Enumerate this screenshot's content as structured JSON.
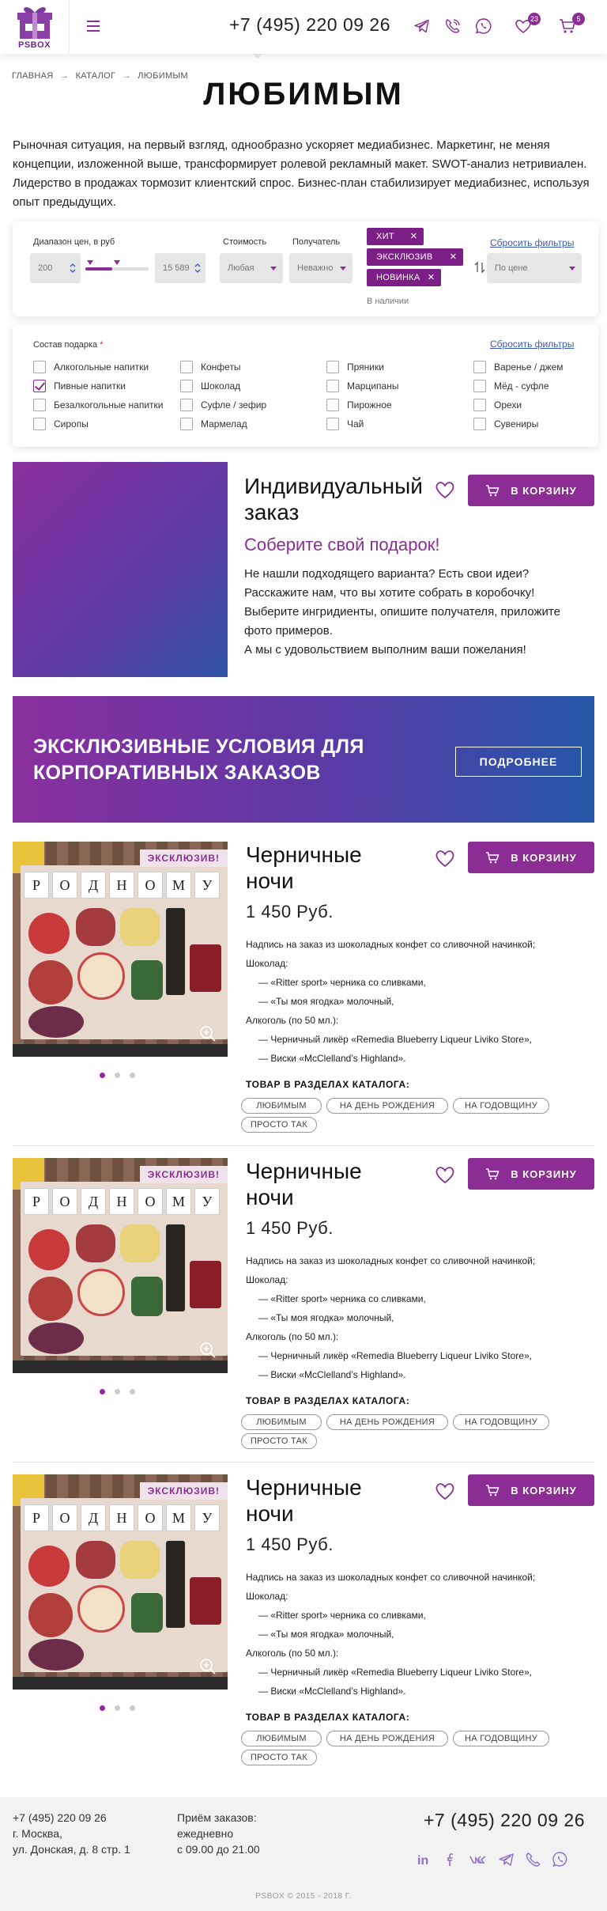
{
  "header": {
    "logo_text": "PSBOX",
    "phone": "+7 (495) 220 09 26",
    "favorites_count": "23",
    "cart_count": "5"
  },
  "breadcrumb": {
    "home": "ГЛАВНАЯ",
    "catalog": "КАТАЛОГ",
    "current": "ЛЮБИМЫМ",
    "separator": "→"
  },
  "page_title": "ЛЮБИМЫМ",
  "intro_text": "Рыночная ситуация, на первый взгляд, однообразно ускоряет медиабизнес. Маркетинг, не меняя концепции, изложенной выше, трансформирует ролевой рекламный макет. SWOT-анализ нетривиален. Лидерство в продажах тормозит клиентский спрос. Бизнес-план стабилизирует медиабизнес, используя опыт предыдущих.",
  "filters": {
    "price_label": "Диапазон цен, в руб",
    "price_min": "200",
    "price_max": "15 589",
    "price_range_fraction": [
      0.0,
      0.42
    ],
    "cost_label": "Стоимость",
    "cost_value": "Любая",
    "recipient_label": "Получатель",
    "recipient_value": "Неважно",
    "tags": [
      "ХИТ",
      "ЭКСКЛЮЗИВ",
      "НОВИНКА"
    ],
    "in_stock": "В наличии",
    "reset_label": "Сбросить фильтры",
    "sort_value": "По цене"
  },
  "composition": {
    "label": "Состав подарка",
    "required_mark": "*",
    "reset_label": "Сбросить фильтры",
    "items": [
      {
        "label": "Алкогольные напитки",
        "checked": false
      },
      {
        "label": "Конфеты",
        "checked": false
      },
      {
        "label": "Пряники",
        "checked": false
      },
      {
        "label": "Варенье / джем",
        "checked": false
      },
      {
        "label": "Пивные напитки",
        "checked": true
      },
      {
        "label": "Шоколад",
        "checked": false
      },
      {
        "label": "Марципаны",
        "checked": false
      },
      {
        "label": "Мёд - суфле",
        "checked": false
      },
      {
        "label": "Безалкогольные напитки",
        "checked": false
      },
      {
        "label": "Суфле / зефир",
        "checked": false
      },
      {
        "label": "Пирожное",
        "checked": false
      },
      {
        "label": "Орехи",
        "checked": false
      },
      {
        "label": "Сиропы",
        "checked": false
      },
      {
        "label": "Мармелад",
        "checked": false
      },
      {
        "label": "Чай",
        "checked": false
      },
      {
        "label": "Сувениры",
        "checked": false
      }
    ]
  },
  "custom_order": {
    "title_line1": "Индивидуальный",
    "title_line2": "заказ",
    "subtitle": "Соберите свой подарок!",
    "body_lines": [
      "Не нашли подходящего варианта? Есть свои идеи?",
      "Расскажите нам, что вы хотите собрать в коробочку!",
      "Выберите ингридиенты, опишите получателя, приложите",
      "фото примеров.",
      "А мы с удовольствием выполним ваши пожелания!"
    ],
    "cart_label": "В КОРЗИНУ"
  },
  "promo": {
    "title_line1": "ЭКСКЛЮЗИВНЫЕ УСЛОВИЯ ДЛЯ",
    "title_line2": "КОРПОРАТИВНЫХ ЗАКАЗОВ",
    "button_label": "ПОДРОБНЕЕ"
  },
  "products": [
    {
      "name_line1": "Черничные",
      "name_line2": "ночи",
      "price": "1 450 Руб.",
      "ribbon": "ЭКСКЛЮЗИВ!",
      "cart_label": "В КОРЗИНУ",
      "tile_letters": [
        "Р",
        "О",
        "Д",
        "Н",
        "О",
        "М",
        "У"
      ],
      "desc_lines": [
        {
          "text": "Надпись на заказ из шоколадных конфет со сливочной начинкой;",
          "indent": false
        },
        {
          "text": "Шоколад:",
          "indent": false
        },
        {
          "text": "— «Ritter sport» черника со сливками,",
          "indent": true
        },
        {
          "text": "— «Ты моя ягодка» молочный,",
          "indent": true
        },
        {
          "text": "Алкоголь (по 50 мл.):",
          "indent": false
        },
        {
          "text": "— Черничный ликёр «Remedia Blueberry Liqueur Liviko Store»,",
          "indent": true
        },
        {
          "text": "— Виски «McClelland’s Highland».",
          "indent": true
        }
      ],
      "catalog_label": "ТОВАР В РАЗДЕЛАХ КАТАЛОГА:",
      "catalog_tags": [
        "ЛЮБИМЫМ",
        "НА ДЕНЬ РОЖДЕНИЯ",
        "НА ГОДОВЩИНУ",
        "ПРОСТО ТАК"
      ]
    },
    {
      "name_line1": "Черничные",
      "name_line2": "ночи",
      "price": "1 450 Руб.",
      "ribbon": "ЭКСКЛЮЗИВ!",
      "cart_label": "В КОРЗИНУ",
      "tile_letters": [
        "Р",
        "О",
        "Д",
        "Н",
        "О",
        "М",
        "У"
      ],
      "desc_lines": [
        {
          "text": "Надпись на заказ из шоколадных конфет со сливочной начинкой;",
          "indent": false
        },
        {
          "text": "Шоколад:",
          "indent": false
        },
        {
          "text": "— «Ritter sport» черника со сливками,",
          "indent": true
        },
        {
          "text": "— «Ты моя ягодка» молочный,",
          "indent": true
        },
        {
          "text": "Алкоголь (по 50 мл.):",
          "indent": false
        },
        {
          "text": "— Черничный ликёр «Remedia Blueberry Liqueur Liviko Store»,",
          "indent": true
        },
        {
          "text": "— Виски «McClelland’s Highland».",
          "indent": true
        }
      ],
      "catalog_label": "ТОВАР В РАЗДЕЛАХ КАТАЛОГА:",
      "catalog_tags": [
        "ЛЮБИМЫМ",
        "НА ДЕНЬ РОЖДЕНИЯ",
        "НА ГОДОВЩИНУ",
        "ПРОСТО ТАК"
      ]
    },
    {
      "name_line1": "Черничные",
      "name_line2": "ночи",
      "price": "1 450 Руб.",
      "ribbon": "ЭКСКЛЮЗИВ!",
      "cart_label": "В КОРЗИНУ",
      "tile_letters": [
        "Р",
        "О",
        "Д",
        "Н",
        "О",
        "М",
        "У"
      ],
      "desc_lines": [
        {
          "text": "Надпись на заказ из шоколадных конфет со сливочной начинкой;",
          "indent": false
        },
        {
          "text": "Шоколад:",
          "indent": false
        },
        {
          "text": "— «Ritter sport» черника со сливками,",
          "indent": true
        },
        {
          "text": "— «Ты моя ягодка» молочный,",
          "indent": true
        },
        {
          "text": "Алкоголь (по 50 мл.):",
          "indent": false
        },
        {
          "text": "— Черничный ликёр «Remedia Blueberry Liqueur Liviko Store»,",
          "indent": true
        },
        {
          "text": "— Виски «McClelland’s Highland».",
          "indent": true
        }
      ],
      "catalog_label": "ТОВАР В РАЗДЕЛАХ КАТАЛОГА:",
      "catalog_tags": [
        "ЛЮБИМЫМ",
        "НА ДЕНЬ РОЖДЕНИЯ",
        "НА ГОДОВЩИНУ",
        "ПРОСТО ТАК"
      ]
    }
  ],
  "footer": {
    "phone_small": "+7 (495) 220 09 26",
    "address_line1": "г. Москва,",
    "address_line2": "ул. Донская, д. 8 стр. 1",
    "hours_line1": "Приём заказов:",
    "hours_line2": "ежедневно",
    "hours_line3": "с 09.00 до 21.00",
    "phone_large": "+7 (495) 220 09 26",
    "copyright": "PSBOX © 2015 - 2018 Г.",
    "social_icons": [
      "linkedin-icon",
      "facebook-icon",
      "vk-icon",
      "telegram-icon",
      "viber-icon",
      "whatsapp-icon"
    ]
  },
  "colors": {
    "accent": "#8b2d94",
    "tag_bg": "#7b1e86",
    "link": "#3a5ab6",
    "promo_gradient": [
      "#8a2f9e",
      "#2457a8"
    ]
  }
}
